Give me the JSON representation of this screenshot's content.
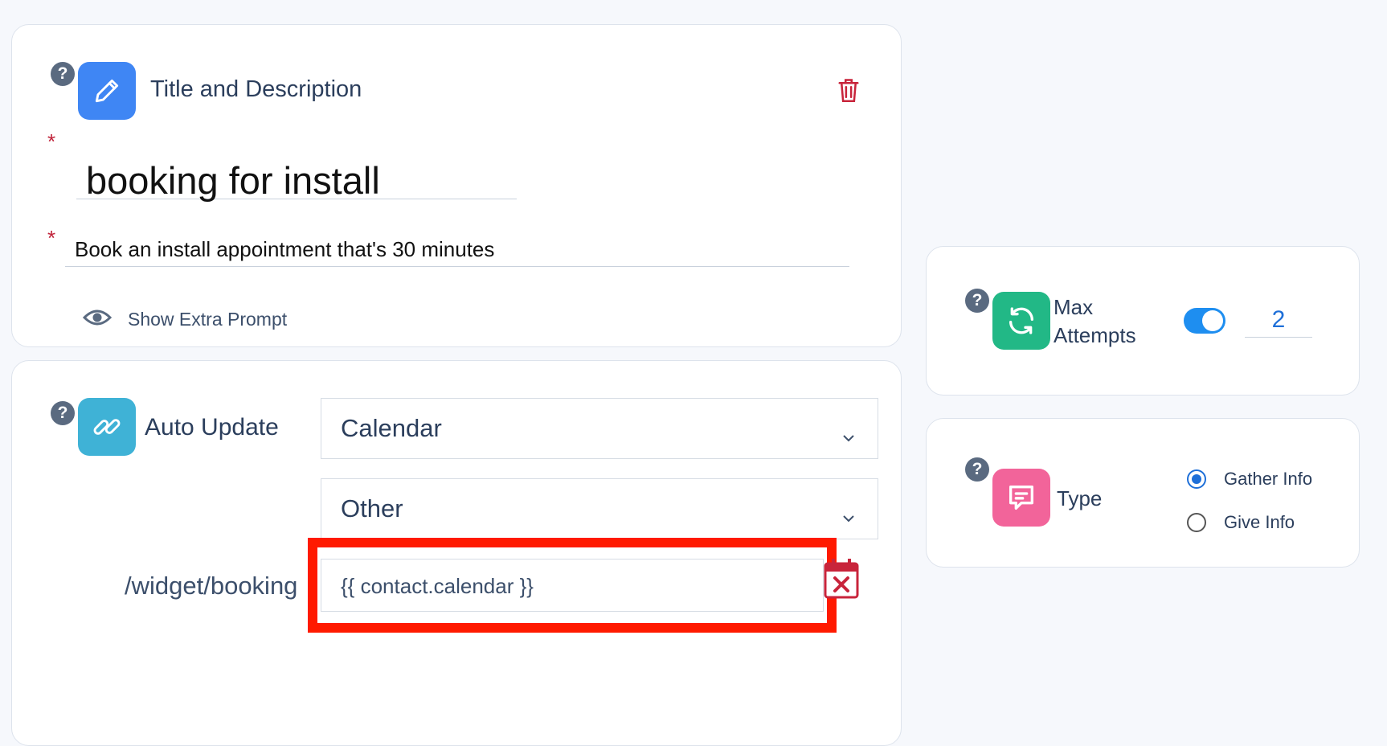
{
  "title_card": {
    "heading": "Title and Description",
    "title_value": "booking for install",
    "description_value": "Book an install appointment that's 30 minutes",
    "required_mark": "*",
    "show_extra_prompt": "Show Extra Prompt"
  },
  "auto_update": {
    "label": "Auto Update",
    "select_1": "Calendar",
    "select_2": "Other",
    "path_label": "/widget/booking",
    "calendar_field_value": "{{ contact.calendar }}"
  },
  "max_attempts": {
    "label_line1": "Max",
    "label_line2": "Attempts",
    "enabled": true,
    "value": "2"
  },
  "type_card": {
    "label": "Type",
    "options": [
      "Gather Info",
      "Give Info"
    ],
    "selected": "Gather Info"
  },
  "help_glyph": "?",
  "colors": {
    "pencil_tile": "#3f86f4",
    "link_tile": "#3fb2d6",
    "attempts_tile": "#22b886",
    "type_tile": "#f2649a",
    "delete": "#c8243b",
    "toggle": "#1e8ef0",
    "highlight": "#ff1a00"
  }
}
